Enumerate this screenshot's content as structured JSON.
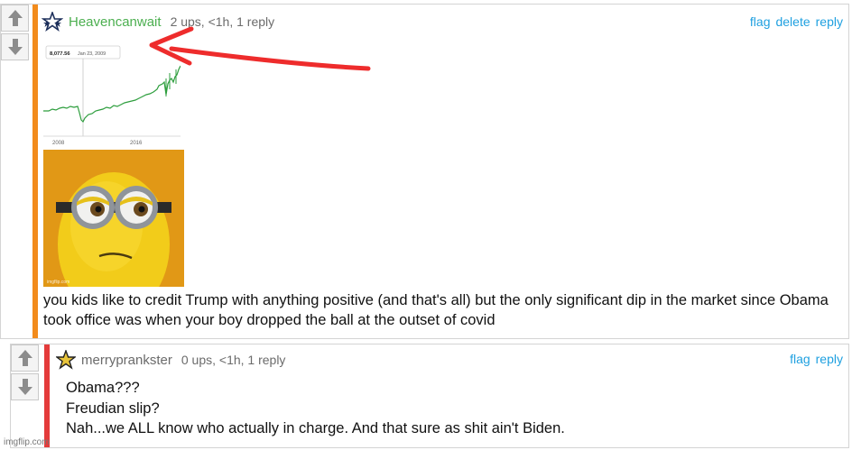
{
  "comment1": {
    "username": "Heavencanwait",
    "meta": "2 ups, <1h, 1 reply",
    "actions": [
      "flag",
      "delete",
      "reply"
    ],
    "chart_data": {
      "type": "line",
      "tooltip_value": "8,077.56",
      "tooltip_date": "Jan 23, 2009",
      "x_tick_labels": [
        "2008",
        "2016"
      ],
      "color": "#2e9e3e"
    },
    "image_small_caption": "imgflip.com",
    "text": "you kids like to credit Trump with anything positive (and that's all) but the only significant dip in the market since Obama took office was when your boy dropped the ball at the outset of covid"
  },
  "comment2": {
    "username": "merryprankster",
    "meta": "0 ups, <1h, 1 reply",
    "actions": [
      "flag",
      "reply"
    ],
    "lines": [
      "Obama???",
      "Freudian slip?",
      "Nah...we ALL know who actually in charge. And that sure as shit ain't Biden."
    ]
  },
  "watermark": "imgflip.com",
  "colors": {
    "accent_orange": "#f28b1c",
    "accent_red": "#e43b3b",
    "username_green": "#4caf50",
    "link_blue": "#1fa0e0",
    "arrow_red": "#ee2c2c"
  }
}
